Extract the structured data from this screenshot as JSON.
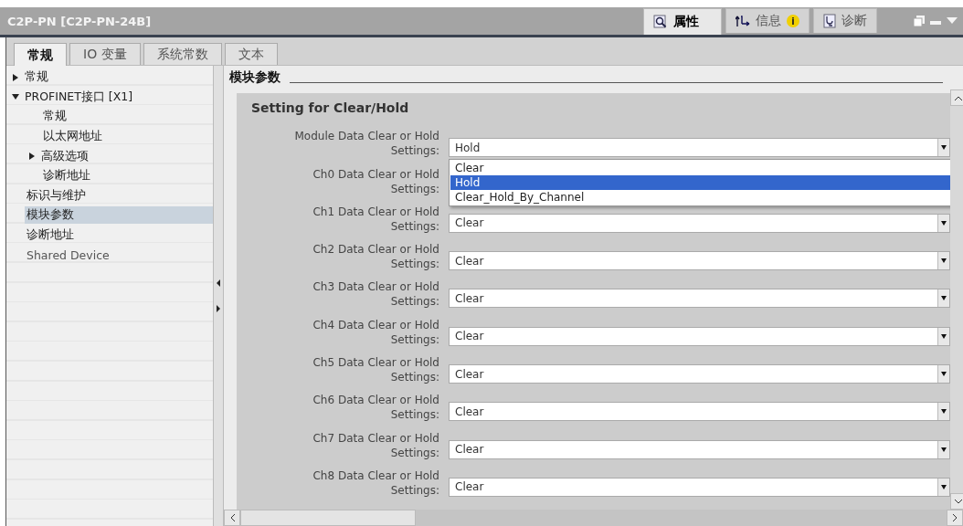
{
  "window": {
    "title": "C2P-PN [C2P-PN-24B]"
  },
  "inspector_tabs": [
    {
      "label": "属性",
      "selected": true,
      "kind": "properties"
    },
    {
      "label": "信息",
      "selected": false,
      "kind": "info",
      "badge": "i"
    },
    {
      "label": "诊断",
      "selected": false,
      "kind": "diagnostics"
    }
  ],
  "tabs": [
    {
      "label": "常规",
      "selected": true
    },
    {
      "label": "IO 变量",
      "selected": false
    },
    {
      "label": "系统常数",
      "selected": false
    },
    {
      "label": "文本",
      "selected": false
    }
  ],
  "tree": [
    {
      "label": "常规",
      "selected": false,
      "expanded": false
    },
    {
      "label": "PROFINET接口 [X1]",
      "selected": false,
      "expanded": true,
      "children": [
        {
          "label": "常规",
          "selected": false
        },
        {
          "label": "以太网地址",
          "selected": false
        },
        {
          "label": "高级选项",
          "selected": false,
          "expanded": false
        },
        {
          "label": "诊断地址",
          "selected": false
        }
      ]
    },
    {
      "label": "标识与维护",
      "selected": false
    },
    {
      "label": "模块参数",
      "selected": true
    },
    {
      "label": "诊断地址",
      "selected": false
    },
    {
      "label": "Shared Device",
      "selected": false,
      "disabled": true
    }
  ],
  "section": {
    "title": "模块参数",
    "group_title": "Setting for Clear/Hold"
  },
  "settings": [
    {
      "label": "Module Data Clear or Hold",
      "label_2": "Settings:",
      "value": "Hold",
      "options": [
        {
          "label": "Clear",
          "selected": false
        },
        {
          "label": "Hold",
          "selected": true
        },
        {
          "label": "Clear_Hold_By_Channel",
          "selected": false
        }
      ]
    },
    {
      "label": "Ch0 Data Clear or Hold",
      "label_2": "Settings:"
    },
    {
      "label": "Ch1 Data Clear or Hold",
      "label_2": "Settings:",
      "value": "Clear"
    },
    {
      "label": "Ch2 Data Clear or Hold",
      "label_2": "Settings:",
      "value": "Clear"
    },
    {
      "label": "Ch3 Data Clear or Hold",
      "label_2": "Settings:",
      "value": "Clear"
    },
    {
      "label": "Ch4 Data Clear or Hold",
      "label_2": "Settings:",
      "value": "Clear"
    },
    {
      "label": "Ch5 Data Clear or Hold",
      "label_2": "Settings:",
      "value": "Clear"
    },
    {
      "label": "Ch6 Data Clear or Hold",
      "label_2": "Settings:",
      "value": "Clear"
    },
    {
      "label": "Ch7 Data Clear or Hold",
      "label_2": "Settings:",
      "value": "Clear"
    },
    {
      "label": "Ch8 Data Clear or Hold",
      "label_2": "Settings:",
      "value": "Clear"
    }
  ]
}
